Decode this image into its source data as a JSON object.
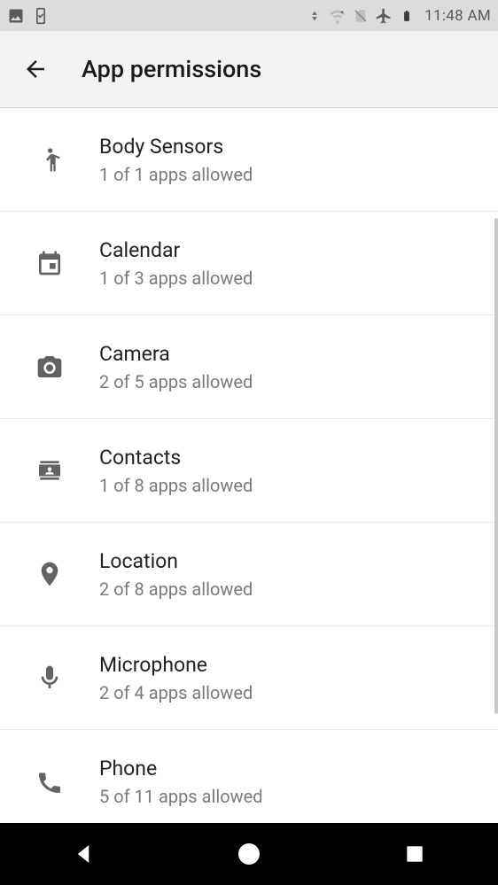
{
  "statusbar": {
    "time": "11:48 AM"
  },
  "header": {
    "title": "App permissions"
  },
  "permissions": [
    {
      "name": "Body Sensors",
      "sub": "1 of 1 apps allowed",
      "icon": "body-sensors"
    },
    {
      "name": "Calendar",
      "sub": "1 of 3 apps allowed",
      "icon": "calendar"
    },
    {
      "name": "Camera",
      "sub": "2 of 5 apps allowed",
      "icon": "camera"
    },
    {
      "name": "Contacts",
      "sub": "1 of 8 apps allowed",
      "icon": "contacts"
    },
    {
      "name": "Location",
      "sub": "2 of 8 apps allowed",
      "icon": "location"
    },
    {
      "name": "Microphone",
      "sub": "2 of 4 apps allowed",
      "icon": "microphone"
    },
    {
      "name": "Phone",
      "sub": "5 of 11 apps allowed",
      "icon": "phone"
    }
  ]
}
